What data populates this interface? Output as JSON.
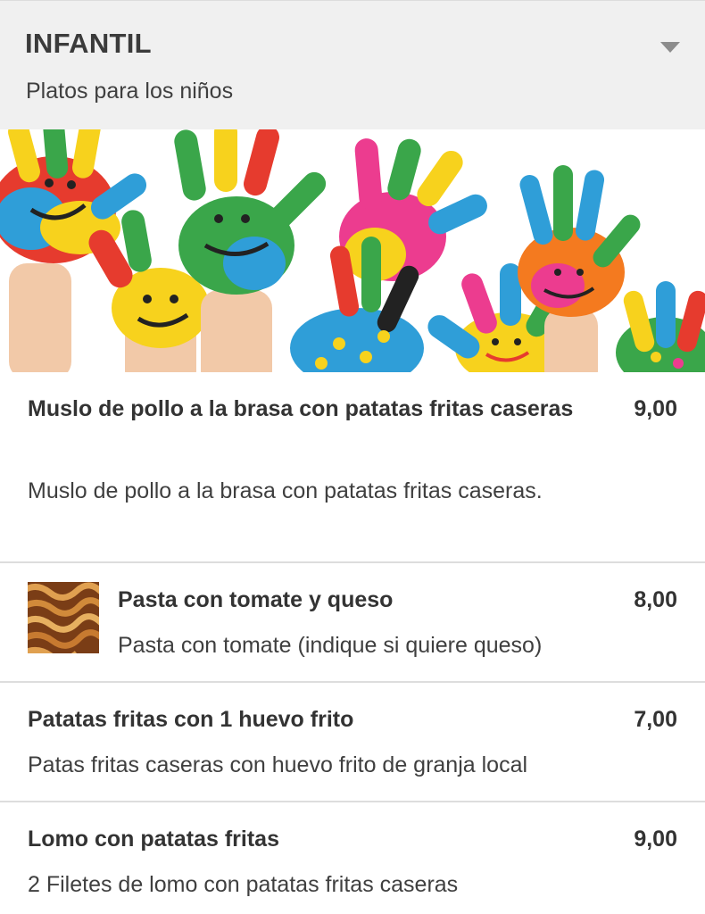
{
  "section": {
    "title": "INFANTIL",
    "subtitle": "Platos para los niños",
    "toggle_icon": "chevron-down-icon"
  },
  "banner": {
    "image": "colorful-painted-kids-hands-banner"
  },
  "items": [
    {
      "name": "Muslo de pollo a la brasa con patatas fritas caseras",
      "description": "Muslo de pollo a la brasa con patatas fritas caseras.",
      "price": "9,00"
    },
    {
      "name": "Pasta con tomate y queso",
      "description": "Pasta con tomate (indique si quiere queso)",
      "price": "8,00",
      "thumbnail": "pasta-thumbnail"
    },
    {
      "name": "Patatas fritas con 1 huevo frito",
      "description": "Patas fritas caseras con huevo frito de granja local",
      "price": "7,00"
    },
    {
      "name": "Lomo con patatas fritas",
      "description": "2 Filetes de lomo con patatas fritas caseras",
      "price": "9,00"
    }
  ],
  "colors": {
    "header_bg": "#f0f0f0",
    "divider": "#dddddd",
    "text_dark": "#333333",
    "chevron": "#8c8c8c"
  }
}
